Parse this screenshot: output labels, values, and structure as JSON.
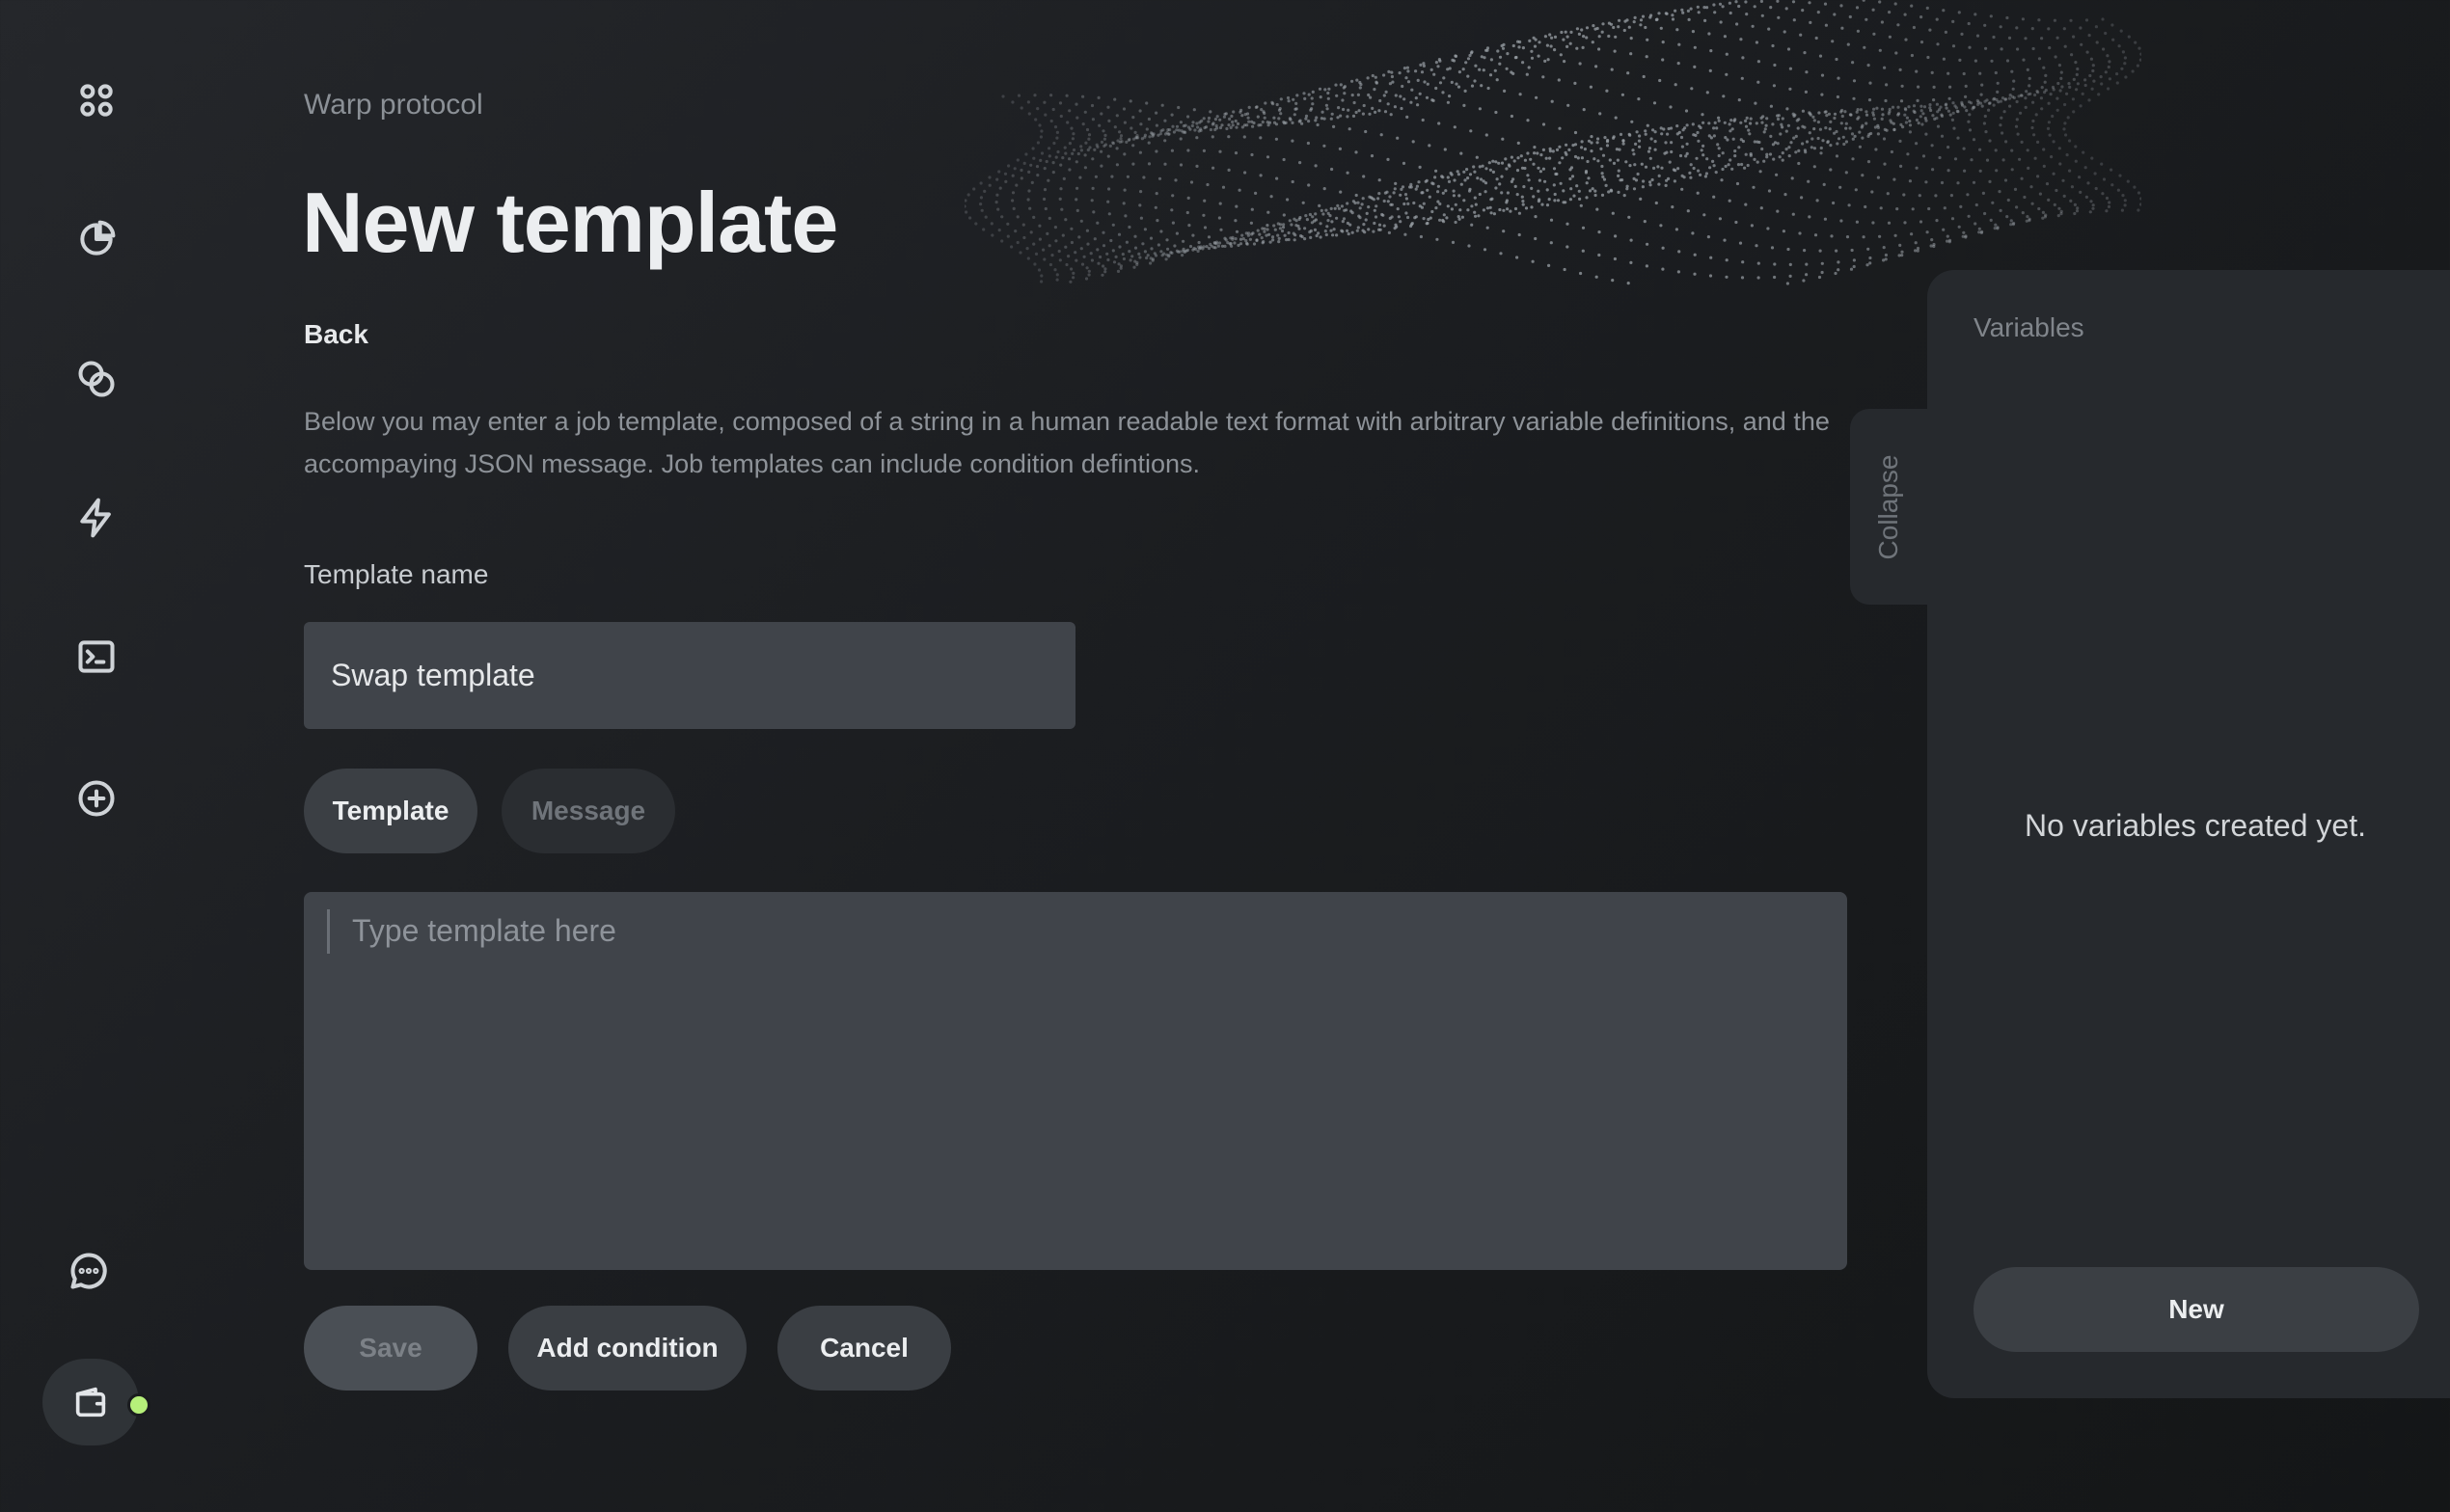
{
  "sidebar": {
    "items": [
      {
        "icon": "grid-icon"
      },
      {
        "icon": "pie-chart-icon"
      },
      {
        "icon": "coins-icon"
      },
      {
        "icon": "lightning-icon"
      },
      {
        "icon": "terminal-icon"
      },
      {
        "icon": "plus-circle-icon"
      },
      {
        "icon": "chat-icon"
      }
    ],
    "wallet": {
      "icon": "wallet-icon",
      "status_color": "#b6f07a"
    }
  },
  "header": {
    "breadcrumb": "Warp protocol",
    "title": "New template",
    "back_label": "Back"
  },
  "description": "Below you may enter a job template, composed of a string in a human readable text format with arbitrary variable definitions, and the accompaying JSON message. Job templates can include condition defintions.",
  "form": {
    "name_label": "Template name",
    "name_value": "Swap template",
    "tabs": [
      {
        "label": "Template",
        "active": true
      },
      {
        "label": "Message",
        "active": false
      }
    ],
    "editor_placeholder": "Type template here",
    "buttons": {
      "save": "Save",
      "add_condition": "Add condition",
      "cancel": "Cancel"
    }
  },
  "variables_panel": {
    "collapse_label": "Collapse",
    "title": "Variables",
    "empty_message": "No variables created yet.",
    "new_label": "New"
  },
  "colors": {
    "background": "#1b1d20",
    "panel": "#26292d",
    "input": "#40444a",
    "accent_green": "#b6f07a"
  }
}
